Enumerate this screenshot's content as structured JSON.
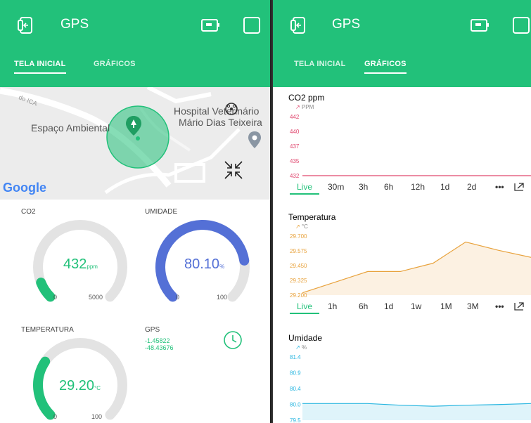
{
  "colors": {
    "accent": "#22c17a",
    "co2": "#e0476e",
    "temp": "#e8a23c",
    "humidity": "#29b6e0",
    "gauge_track": "#e3e3e3",
    "humidity_gauge": "#5470d6"
  },
  "left": {
    "app_title": "GPS",
    "tabs": [
      "TELA INICIAL",
      "GRÁFICOS"
    ],
    "active_tab": 0,
    "map": {
      "label_place": "Espaço Ambiental",
      "label_hospital_1": "Hospital Veterinário",
      "label_hospital_2": "Mário Dias Teixeira",
      "street": "do ICA",
      "logo": "Google"
    },
    "gauges": [
      {
        "label": "CO2",
        "value": "432",
        "unit": "ppm",
        "min": "0",
        "max": "5000",
        "fraction": 0.0864
      },
      {
        "label": "UMIDADE",
        "value": "80.10",
        "unit": "%",
        "min": "0",
        "max": "100",
        "fraction": 0.801
      },
      {
        "label": "TEMPERATURA",
        "value": "29.20",
        "unit": "°C",
        "min": "0",
        "max": "100",
        "fraction": 0.292
      }
    ],
    "gps": {
      "label": "GPS",
      "lat": "-1.45822",
      "lon": "-48.43676"
    }
  },
  "right": {
    "app_title": "GPS",
    "tabs": [
      "TELA INICIAL",
      "GRÁFICOS"
    ],
    "active_tab": 1
  },
  "chart_data": [
    {
      "type": "line",
      "title": "CO2 ppm",
      "series_label": "PPM",
      "ticks": [
        "442",
        "440",
        "437",
        "435",
        "432"
      ],
      "ylim": [
        432,
        442
      ],
      "series": [
        {
          "values": [
            432,
            432,
            432,
            432,
            432,
            432,
            432,
            432
          ]
        }
      ],
      "periods": [
        "Live",
        "30m",
        "3h",
        "6h",
        "12h",
        "1d",
        "2d",
        "•••"
      ]
    },
    {
      "type": "area",
      "title": "Temperatura",
      "series_label": "°C",
      "ticks": [
        "29.700",
        "29.575",
        "29.450",
        "29.325",
        "29.200"
      ],
      "ylim": [
        29.2,
        29.7
      ],
      "series": [
        {
          "values": [
            29.22,
            29.31,
            29.4,
            29.4,
            29.47,
            29.65,
            29.58,
            29.52
          ]
        }
      ],
      "periods": [
        "Live",
        "1h",
        "6h",
        "1d",
        "1w",
        "1M",
        "3M",
        "•••"
      ]
    },
    {
      "type": "area",
      "title": "Umidade",
      "series_label": "%",
      "ticks": [
        "81.4",
        "80.9",
        "80.4",
        "80.0",
        "79.5"
      ],
      "ylim": [
        79.5,
        81.4
      ],
      "series": [
        {
          "values": [
            80.0,
            80.0,
            80.0,
            79.95,
            79.92,
            79.95,
            79.97,
            80.0
          ]
        }
      ],
      "periods": []
    }
  ]
}
